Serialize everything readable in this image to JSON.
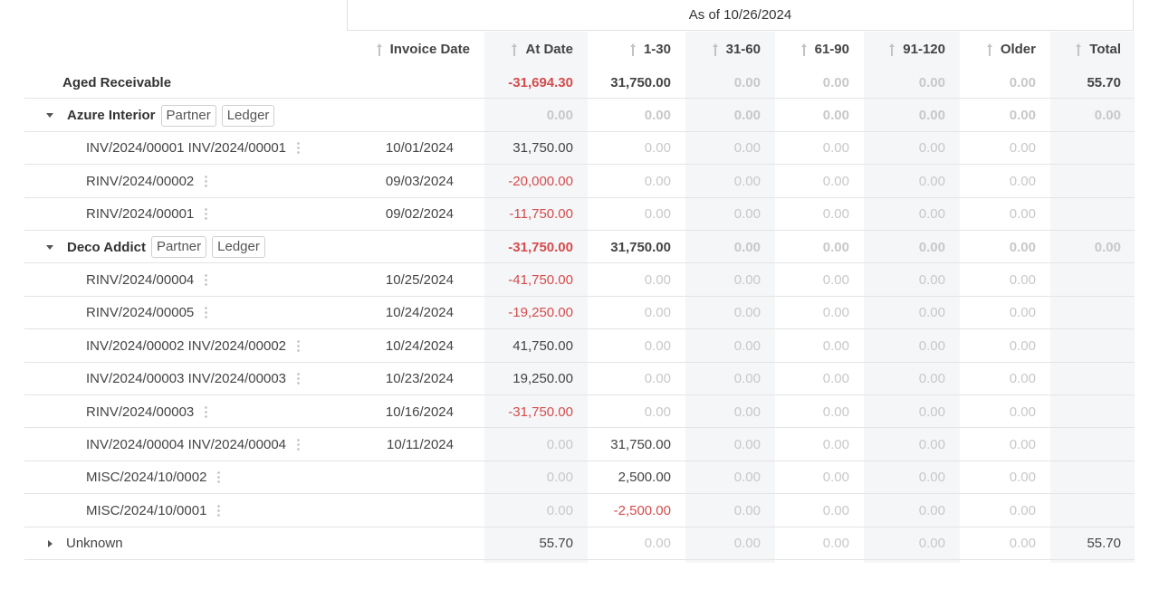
{
  "header": {
    "as_of": "As of 10/26/2024"
  },
  "columns": [
    {
      "key": "invoice_date",
      "label": "Invoice Date"
    },
    {
      "key": "at_date",
      "label": "At Date"
    },
    {
      "key": "d1_30",
      "label": "1-30"
    },
    {
      "key": "d31_60",
      "label": "31-60"
    },
    {
      "key": "d61_90",
      "label": "61-90"
    },
    {
      "key": "d91_120",
      "label": "91-120"
    },
    {
      "key": "older",
      "label": "Older"
    },
    {
      "key": "total",
      "label": "Total"
    }
  ],
  "rows": [
    {
      "kind": "total",
      "label": "Aged Receivable",
      "values": [
        "",
        "-31,694.30",
        "31,750.00",
        "0.00",
        "0.00",
        "0.00",
        "0.00",
        "55.70"
      ]
    },
    {
      "kind": "partner",
      "label": "Azure Interior",
      "tags": [
        "Partner",
        "Ledger"
      ],
      "values": [
        "",
        "0.00",
        "0.00",
        "0.00",
        "0.00",
        "0.00",
        "0.00",
        "0.00"
      ]
    },
    {
      "kind": "line",
      "label": "INV/2024/00001 INV/2024/00001",
      "values": [
        "10/01/2024",
        "31,750.00",
        "0.00",
        "0.00",
        "0.00",
        "0.00",
        "0.00",
        ""
      ]
    },
    {
      "kind": "line",
      "label": "RINV/2024/00002",
      "values": [
        "09/03/2024",
        "-20,000.00",
        "0.00",
        "0.00",
        "0.00",
        "0.00",
        "0.00",
        ""
      ]
    },
    {
      "kind": "line",
      "label": "RINV/2024/00001",
      "values": [
        "09/02/2024",
        "-11,750.00",
        "0.00",
        "0.00",
        "0.00",
        "0.00",
        "0.00",
        ""
      ]
    },
    {
      "kind": "partner",
      "label": "Deco Addict",
      "tags": [
        "Partner",
        "Ledger"
      ],
      "values": [
        "",
        "-31,750.00",
        "31,750.00",
        "0.00",
        "0.00",
        "0.00",
        "0.00",
        "0.00"
      ]
    },
    {
      "kind": "line",
      "label": "RINV/2024/00004",
      "values": [
        "10/25/2024",
        "-41,750.00",
        "0.00",
        "0.00",
        "0.00",
        "0.00",
        "0.00",
        ""
      ]
    },
    {
      "kind": "line",
      "label": "RINV/2024/00005",
      "values": [
        "10/24/2024",
        "-19,250.00",
        "0.00",
        "0.00",
        "0.00",
        "0.00",
        "0.00",
        ""
      ]
    },
    {
      "kind": "line",
      "label": "INV/2024/00002 INV/2024/00002",
      "values": [
        "10/24/2024",
        "41,750.00",
        "0.00",
        "0.00",
        "0.00",
        "0.00",
        "0.00",
        ""
      ]
    },
    {
      "kind": "line",
      "label": "INV/2024/00003 INV/2024/00003",
      "values": [
        "10/23/2024",
        "19,250.00",
        "0.00",
        "0.00",
        "0.00",
        "0.00",
        "0.00",
        ""
      ]
    },
    {
      "kind": "line",
      "label": "RINV/2024/00003",
      "values": [
        "10/16/2024",
        "-31,750.00",
        "0.00",
        "0.00",
        "0.00",
        "0.00",
        "0.00",
        ""
      ]
    },
    {
      "kind": "line",
      "label": "INV/2024/00004 INV/2024/00004",
      "values": [
        "10/11/2024",
        "0.00",
        "31,750.00",
        "0.00",
        "0.00",
        "0.00",
        "0.00",
        ""
      ]
    },
    {
      "kind": "line",
      "label": "MISC/2024/10/0002",
      "values": [
        "",
        "0.00",
        "2,500.00",
        "0.00",
        "0.00",
        "0.00",
        "0.00",
        ""
      ]
    },
    {
      "kind": "line",
      "label": "MISC/2024/10/0001",
      "values": [
        "",
        "0.00",
        "-2,500.00",
        "0.00",
        "0.00",
        "0.00",
        "0.00",
        ""
      ]
    },
    {
      "kind": "collapsed",
      "label": "Unknown",
      "values": [
        "",
        "55.70",
        "0.00",
        "0.00",
        "0.00",
        "0.00",
        "0.00",
        "55.70"
      ]
    }
  ],
  "colors": {
    "negative": "#d44c4c",
    "zero": "#c8c8c8",
    "band": "#f5f6f8"
  }
}
